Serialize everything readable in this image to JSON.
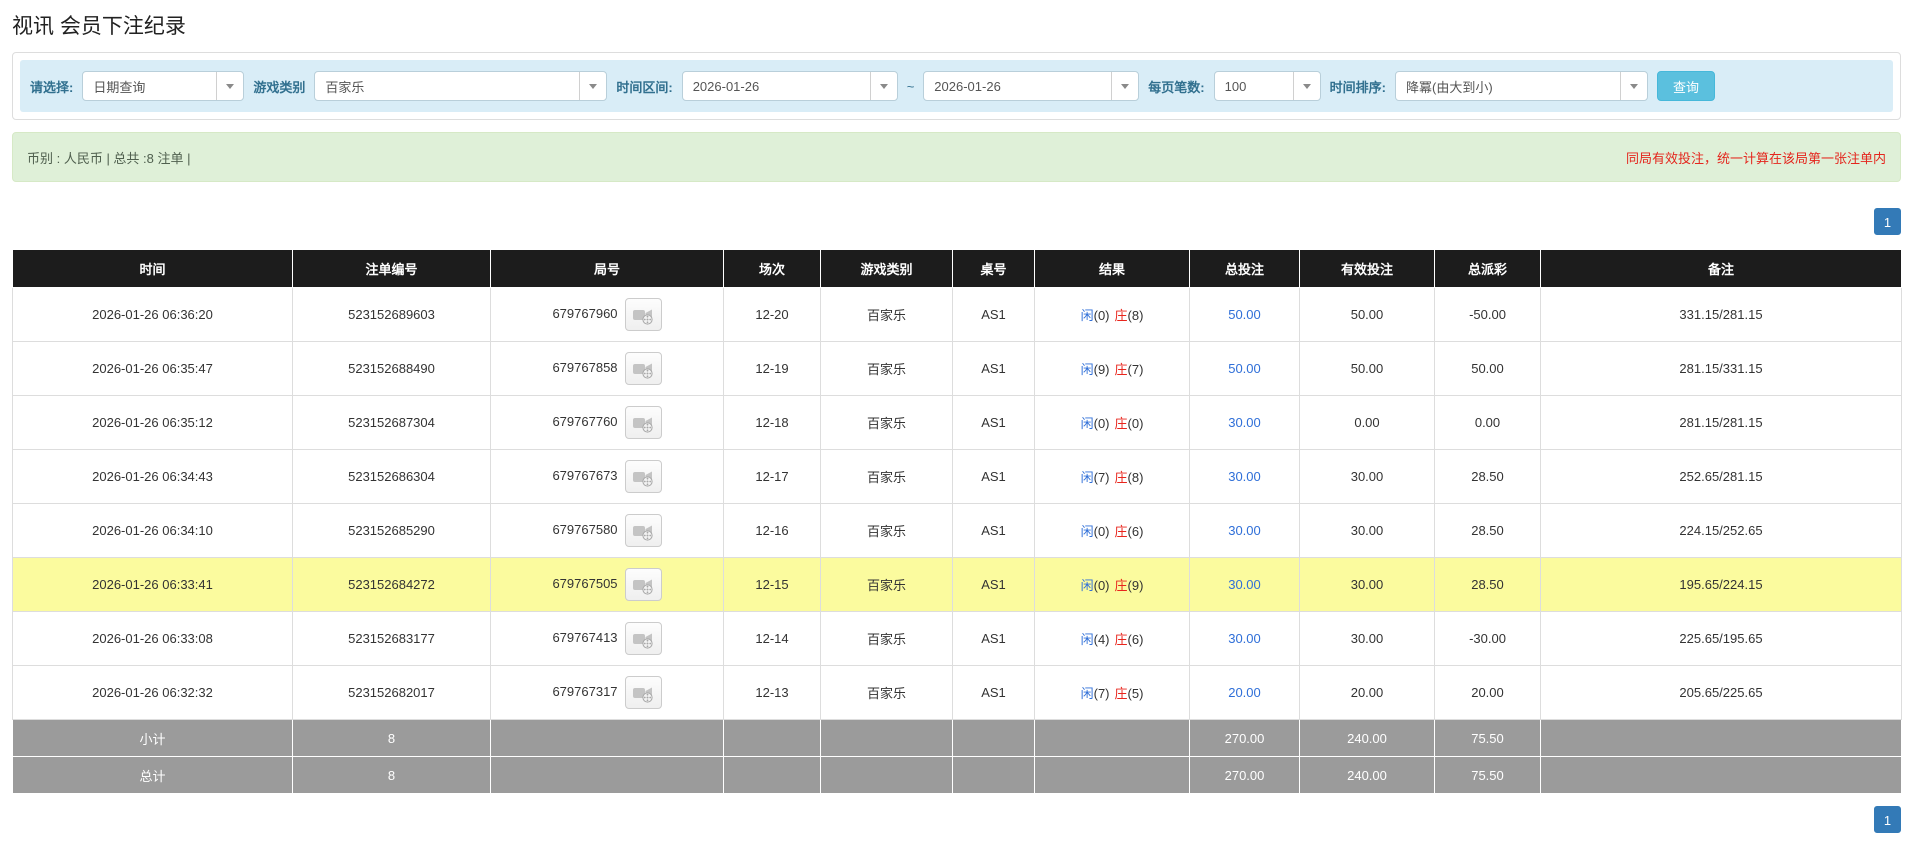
{
  "page": {
    "title": "视讯 会员下注纪录"
  },
  "filters": {
    "select_label": "请选择:",
    "select_value": "日期查询",
    "game_type_label": "游戏类别",
    "game_type_value": "百家乐",
    "time_range_label": "时间区间:",
    "date_from": "2026-01-26",
    "date_to": "2026-01-26",
    "range_separator": "~",
    "per_page_label": "每页笔数:",
    "per_page_value": "100",
    "sort_label": "时间排序:",
    "sort_value": "降冪(由大到小)",
    "search_button": "查询"
  },
  "summary": {
    "left_text": "币别 : 人民币 | 总共 :8 注单 |",
    "right_notice": "同局有效投注，统一计算在该局第一张注单内"
  },
  "pagination": {
    "page": "1"
  },
  "icons": {
    "round_video_icon": "video-icon",
    "select_arrow": "chevron-down-icon"
  },
  "colors": {
    "header_bg": "#1c1c1c",
    "highlight_yellow": "#fbfb9e",
    "totals_gray": "#9b9b9b",
    "link_blue": "#2f6fd8",
    "banker_red": "#e8251c",
    "negative_red": "#f10b0b",
    "notice_red": "#e4261d",
    "filter_bar_bg": "#d9edf7",
    "summary_bg": "#dff0d8",
    "search_button_bg": "#5bc0de",
    "pagination_bg": "#337ab7"
  },
  "table": {
    "headers": [
      "时间",
      "注单编号",
      "局号",
      "场次",
      "游戏类别",
      "桌号",
      "结果",
      "总投注",
      "有效投注",
      "总派彩",
      "备注"
    ],
    "result_labels": {
      "player": "闲",
      "banker": "庄"
    },
    "rows": [
      {
        "time": "2026-01-26 06:36:20",
        "bet_id": "523152689603",
        "round_id": "679767960",
        "session": "12-20",
        "game": "百家乐",
        "table_no": "AS1",
        "player_score": "(0)",
        "banker_score": "(8)",
        "total_bet": "50.00",
        "valid_bet": "50.00",
        "payout": "-50.00",
        "payout_negative": true,
        "remark": "331.15/281.15",
        "highlight": false
      },
      {
        "time": "2026-01-26 06:35:47",
        "bet_id": "523152688490",
        "round_id": "679767858",
        "session": "12-19",
        "game": "百家乐",
        "table_no": "AS1",
        "player_score": "(9)",
        "banker_score": "(7)",
        "total_bet": "50.00",
        "valid_bet": "50.00",
        "payout": "50.00",
        "payout_negative": false,
        "remark": "281.15/331.15",
        "highlight": false
      },
      {
        "time": "2026-01-26 06:35:12",
        "bet_id": "523152687304",
        "round_id": "679767760",
        "session": "12-18",
        "game": "百家乐",
        "table_no": "AS1",
        "player_score": "(0)",
        "banker_score": "(0)",
        "total_bet": "30.00",
        "valid_bet": "0.00",
        "payout": "0.00",
        "payout_negative": false,
        "remark": "281.15/281.15",
        "highlight": false
      },
      {
        "time": "2026-01-26 06:34:43",
        "bet_id": "523152686304",
        "round_id": "679767673",
        "session": "12-17",
        "game": "百家乐",
        "table_no": "AS1",
        "player_score": "(7)",
        "banker_score": "(8)",
        "total_bet": "30.00",
        "valid_bet": "30.00",
        "payout": "28.50",
        "payout_negative": false,
        "remark": "252.65/281.15",
        "highlight": false
      },
      {
        "time": "2026-01-26 06:34:10",
        "bet_id": "523152685290",
        "round_id": "679767580",
        "session": "12-16",
        "game": "百家乐",
        "table_no": "AS1",
        "player_score": "(0)",
        "banker_score": "(6)",
        "total_bet": "30.00",
        "valid_bet": "30.00",
        "payout": "28.50",
        "payout_negative": false,
        "remark": "224.15/252.65",
        "highlight": false
      },
      {
        "time": "2026-01-26 06:33:41",
        "bet_id": "523152684272",
        "round_id": "679767505",
        "session": "12-15",
        "game": "百家乐",
        "table_no": "AS1",
        "player_score": "(0)",
        "banker_score": "(9)",
        "total_bet": "30.00",
        "valid_bet": "30.00",
        "payout": "28.50",
        "payout_negative": false,
        "remark": "195.65/224.15",
        "highlight": true
      },
      {
        "time": "2026-01-26 06:33:08",
        "bet_id": "523152683177",
        "round_id": "679767413",
        "session": "12-14",
        "game": "百家乐",
        "table_no": "AS1",
        "player_score": "(4)",
        "banker_score": "(6)",
        "total_bet": "30.00",
        "valid_bet": "30.00",
        "payout": "-30.00",
        "payout_negative": true,
        "remark": "225.65/195.65",
        "highlight": false
      },
      {
        "time": "2026-01-26 06:32:32",
        "bet_id": "523152682017",
        "round_id": "679767317",
        "session": "12-13",
        "game": "百家乐",
        "table_no": "AS1",
        "player_score": "(7)",
        "banker_score": "(5)",
        "total_bet": "20.00",
        "valid_bet": "20.00",
        "payout": "20.00",
        "payout_negative": false,
        "remark": "205.65/225.65",
        "highlight": false
      }
    ],
    "subtotal": {
      "label": "小计",
      "count": "8",
      "total_bet": "270.00",
      "valid_bet": "240.00",
      "payout": "75.50"
    },
    "total": {
      "label": "总计",
      "count": "8",
      "total_bet": "270.00",
      "valid_bet": "240.00",
      "payout": "75.50"
    }
  }
}
